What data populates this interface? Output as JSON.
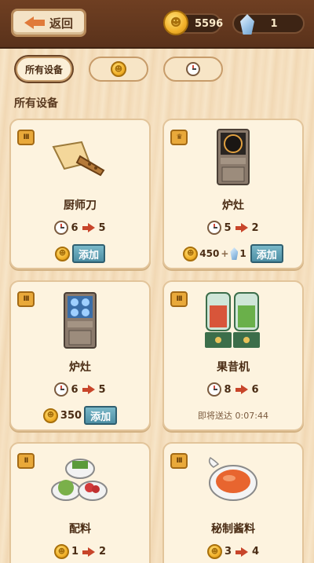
{
  "header": {
    "back_label": "返回",
    "coins": "5596",
    "gems": "1"
  },
  "tabs": [
    {
      "label": "所有设备",
      "icon": "",
      "active": true
    },
    {
      "label": "",
      "icon": "coin-icon",
      "active": false
    },
    {
      "label": "",
      "icon": "clock-icon",
      "active": false
    }
  ],
  "section_title": "所有设备",
  "items": [
    {
      "name": "厨师刀",
      "tier": "III",
      "from": "6",
      "to": "5",
      "add_label": "添加",
      "cost": "",
      "gem_cost": "",
      "timer": ""
    },
    {
      "name": "炉灶",
      "tier": "crown",
      "from": "5",
      "to": "2",
      "add_label": "添加",
      "cost": "450",
      "gem_cost": "1",
      "timer": ""
    },
    {
      "name": "炉灶",
      "tier": "III",
      "from": "6",
      "to": "5",
      "add_label": "添加",
      "cost": "350",
      "gem_cost": "",
      "timer": ""
    },
    {
      "name": "果昔机",
      "tier": "III",
      "from": "8",
      "to": "6",
      "add_label": "",
      "cost": "",
      "gem_cost": "",
      "timer": "即将送达 0:07:44"
    },
    {
      "name": "配料",
      "tier": "II",
      "from": "1",
      "to": "2",
      "add_label": "",
      "cost": "",
      "gem_cost": "",
      "timer": ""
    },
    {
      "name": "秘制酱料",
      "tier": "III",
      "from": "3",
      "to": "4",
      "add_label": "",
      "cost": "",
      "gem_cost": "",
      "timer": ""
    }
  ],
  "colors": {
    "accent": "#4d8ea3",
    "wood_dark": "#5a321b",
    "arrow": "#c8452a",
    "coin": "#f2b12a"
  }
}
